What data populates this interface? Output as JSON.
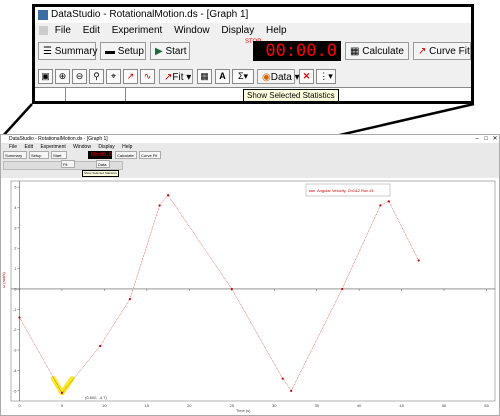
{
  "app": {
    "title": "DataStudio - RotationalMotion.ds - [Graph 1]",
    "menu": [
      "File",
      "Edit",
      "Experiment",
      "Window",
      "Display",
      "Help"
    ]
  },
  "toolbar": {
    "summary_label": "Summary",
    "setup_label": "Setup",
    "start_label": "Start",
    "stop_label": "STOP",
    "timer_value": "00:00.0",
    "calculate_label": "Calculate",
    "curve_fit_label": "Curve Fit"
  },
  "graph_toolbar": {
    "fit_label": "Fit",
    "data_label": "Data",
    "tooltip": "Show Selected Statistics"
  },
  "graph": {
    "legend_text": "Angular Velocity, Ch1&2 Run #1",
    "selected_point_label": "(0.800, -4.7)",
    "x_axis_title": "Time (s)",
    "y_axis_title": "ω (rad/s)",
    "cursor_color": "#f2e600",
    "series_color": "#cc0000"
  },
  "chart_data": {
    "type": "scatter",
    "x_ticks": [
      "0",
      "5",
      "10",
      "15",
      "20",
      "25",
      "30",
      "35",
      "40",
      "45",
      "50",
      "55"
    ],
    "y_ticks": [
      "5",
      "4",
      "3",
      "2",
      "1",
      "0",
      "-1",
      "-2",
      "-3",
      "-4",
      "-5"
    ],
    "xlim": [
      -1,
      56
    ],
    "ylim": [
      -5.5,
      5.3
    ],
    "grid": false,
    "legend_position": "top-right",
    "series": [
      {
        "name": "Angular Velocity, Ch1&2 Run #1",
        "x": [
          0,
          5.0,
          9.5,
          13,
          16.5,
          17.5,
          25,
          31,
          32,
          38,
          42.5,
          43.5,
          47
        ],
        "y": [
          -1.4,
          -5.1,
          -2.8,
          -0.5,
          4.1,
          4.6,
          0.0,
          -4.4,
          -5.0,
          0.0,
          4.1,
          4.3,
          1.4
        ]
      }
    ]
  }
}
